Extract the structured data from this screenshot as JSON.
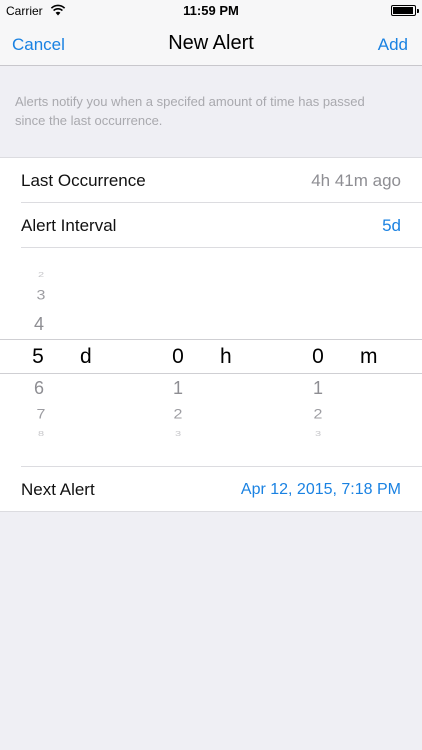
{
  "status": {
    "carrier": "Carrier",
    "time": "11:59 PM",
    "battery_level": 0.95
  },
  "nav": {
    "cancel_label": "Cancel",
    "title": "New Alert",
    "add_label": "Add"
  },
  "description": "Alerts notify you when a specifed amount of time has passed since the last occurrence.",
  "rows": {
    "last_occurrence": {
      "label": "Last Occurrence",
      "value": "4h 41m ago"
    },
    "alert_interval": {
      "label": "Alert Interval",
      "value": "5d"
    },
    "next_alert": {
      "label": "Next Alert",
      "value": "Apr 12, 2015, 7:18 PM"
    }
  },
  "picker": {
    "days": {
      "above": [
        "2",
        "3",
        "4"
      ],
      "selected": "5",
      "below": [
        "6",
        "7",
        "8"
      ],
      "unit": "d"
    },
    "hours": {
      "above": [],
      "selected": "0",
      "below": [
        "1",
        "2",
        "3"
      ],
      "unit": "h"
    },
    "minutes": {
      "above": [],
      "selected": "0",
      "below": [
        "1",
        "2",
        "3"
      ],
      "unit": "m"
    }
  },
  "colors": {
    "accent": "#1a82e2",
    "background": "#efeff4",
    "secondary_text": "#8e8e93"
  }
}
